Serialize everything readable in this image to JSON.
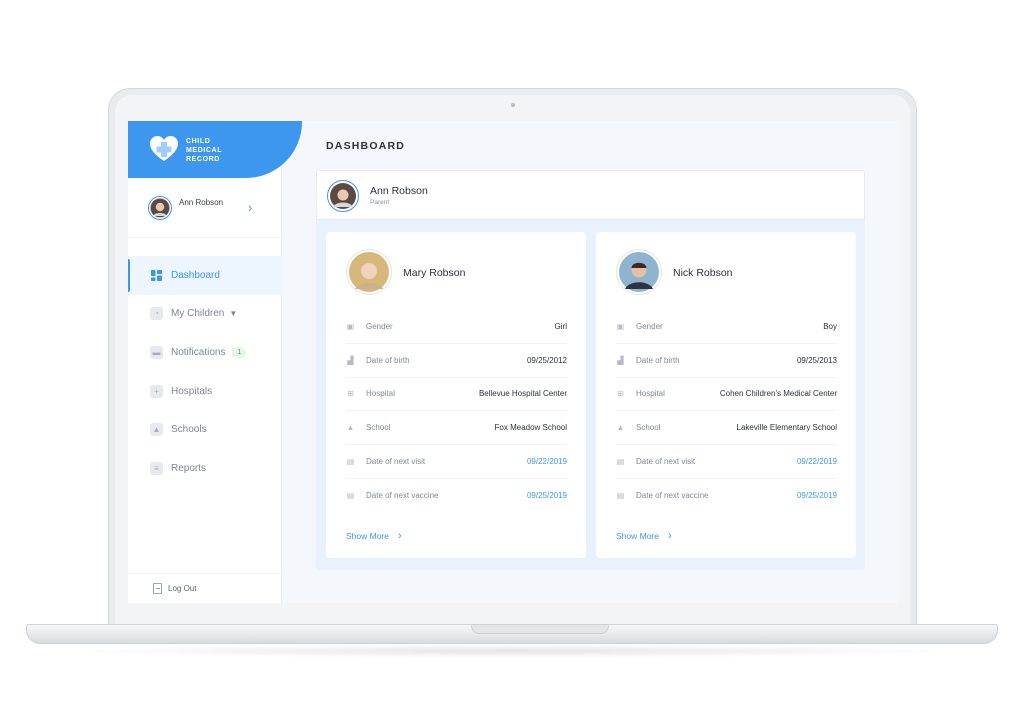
{
  "app": {
    "brand_line1": "CHILD",
    "brand_line2": "MEDICAL",
    "brand_line3": "RECORD",
    "accent_color": "#3d97ee"
  },
  "sidebar": {
    "profile": {
      "name": "Ann Robson",
      "chevron_icon": "chevron-right-icon"
    },
    "items": [
      {
        "label": "Dashboard",
        "icon": "dashboard-icon",
        "active": true
      },
      {
        "label": "My Children",
        "icon": "children-icon",
        "dropdown": true
      },
      {
        "label": "Notifications",
        "icon": "notifications-icon",
        "badge": "1"
      },
      {
        "label": "Hospitals",
        "icon": "hospital-icon"
      },
      {
        "label": "Schools",
        "icon": "school-icon"
      },
      {
        "label": "Reports",
        "icon": "reports-icon"
      }
    ],
    "logout_label": "Log Out"
  },
  "main": {
    "title": "DASHBOARD",
    "parent": {
      "name": "Ann Robson",
      "role": "Parent"
    },
    "children": [
      {
        "name": "Mary Robson",
        "rows": [
          {
            "label": "Gender",
            "value": "Girl"
          },
          {
            "label": "Date of birth",
            "value": "09/25/2012"
          },
          {
            "label": "Hospital",
            "value": "Bellevue Hospital Center"
          },
          {
            "label": "School",
            "value": "Fox Meadow School"
          },
          {
            "label": "Date of next visit",
            "value": "09/22/2019"
          },
          {
            "label": "Date of next vaccine",
            "value": "09/25/2019"
          }
        ],
        "show_more": "Show More"
      },
      {
        "name": "Nick Robson",
        "rows": [
          {
            "label": "Gender",
            "value": "Boy"
          },
          {
            "label": "Date of birth",
            "value": "09/25/2013"
          },
          {
            "label": "Hospital",
            "value": "Cohen Children's Medical Center"
          },
          {
            "label": "School",
            "value": "Lakeville Elementary School"
          },
          {
            "label": "Date of next visit",
            "value": "09/22/2019"
          },
          {
            "label": "Date of next vaccine",
            "value": "09/25/2019"
          }
        ],
        "show_more": "Show More"
      }
    ]
  }
}
